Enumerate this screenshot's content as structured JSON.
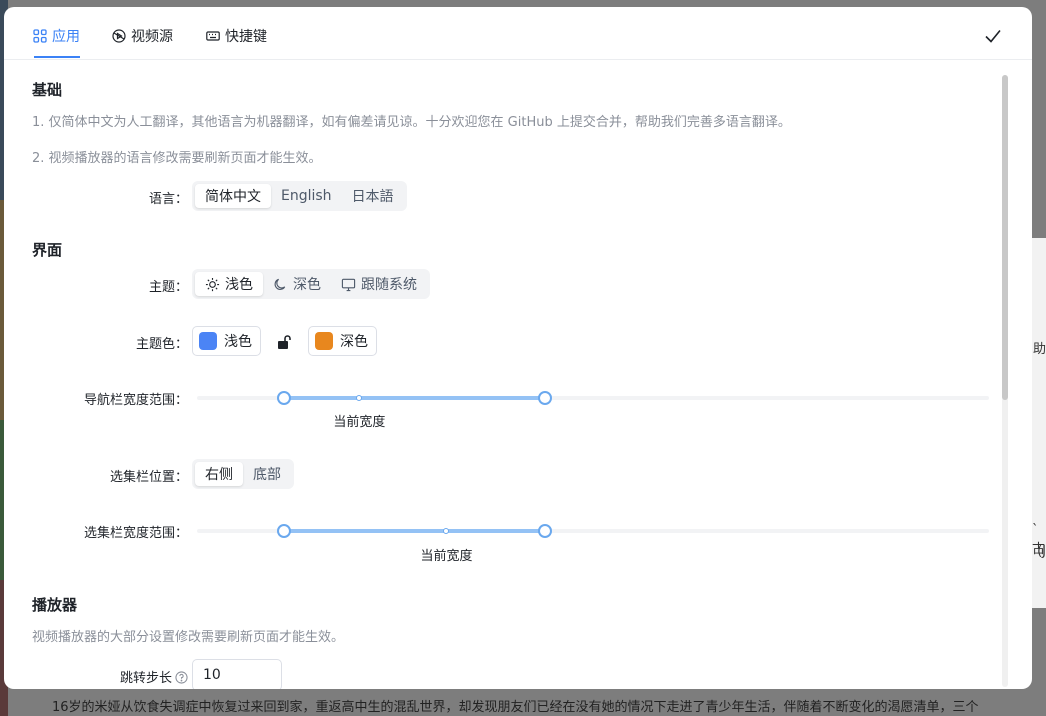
{
  "background": {
    "right_texts": [
      "助",
      "`古",
      "(J"
    ],
    "bottom_text": "16岁的米娅从饮食失调症中恢复过来回到家，重返高中生的混乱世界，却发现朋友们已经在没有她的情况下走进了青少年生活，伴随着不断变化的渴愿清单，三个"
  },
  "tabs": [
    {
      "label": "应用",
      "icon": "grid-icon"
    },
    {
      "label": "视频源",
      "icon": "video-source-icon"
    },
    {
      "label": "快捷键",
      "icon": "keyboard-icon"
    }
  ],
  "confirm_icon": "check-icon",
  "basic": {
    "title": "基础",
    "note1": "1. 仅简体中文为人工翻译，其他语言为机器翻译，如有偏差请见谅。十分欢迎您在 GitHub 上提交合并，帮助我们完善多语言翻译。",
    "note2": "2. 视频播放器的语言修改需要刷新页面才能生效。",
    "language_label": "语言：",
    "languages": [
      "简体中文",
      "English",
      "日本語"
    ],
    "language_selected": "简体中文"
  },
  "interface": {
    "title": "界面",
    "theme_label": "主题：",
    "themes": [
      {
        "label": "浅色",
        "icon": "sun-icon"
      },
      {
        "label": "深色",
        "icon": "moon-icon"
      },
      {
        "label": "跟随系统",
        "icon": "monitor-icon"
      }
    ],
    "theme_selected": "浅色",
    "theme_color_label": "主题色：",
    "light_color": {
      "label": "浅色",
      "color": "#4b84f5"
    },
    "dark_color": {
      "label": "深色",
      "color": "#e8871e"
    },
    "lock_icon": "unlock-icon",
    "nav_width_label": "导航栏宽度范围：",
    "nav_width": {
      "min_pct": 11,
      "max_pct": 44,
      "current_pct": 20.5,
      "mark": "当前宽度"
    },
    "episode_pos_label": "选集栏位置：",
    "episode_positions": [
      "右侧",
      "底部"
    ],
    "episode_pos_selected": "右侧",
    "episode_width_label": "选集栏宽度范围：",
    "episode_width": {
      "min_pct": 11,
      "max_pct": 44,
      "current_pct": 31.5,
      "mark": "当前宽度"
    }
  },
  "player": {
    "title": "播放器",
    "note": "视频播放器的大部分设置修改需要刷新页面才能生效。",
    "seek_step_label": "跳转步长",
    "seek_step_value": "10",
    "help_icon": "help-circle-icon"
  },
  "colors": {
    "accent": "#3b82f6",
    "slider": "#6aa8ee"
  }
}
